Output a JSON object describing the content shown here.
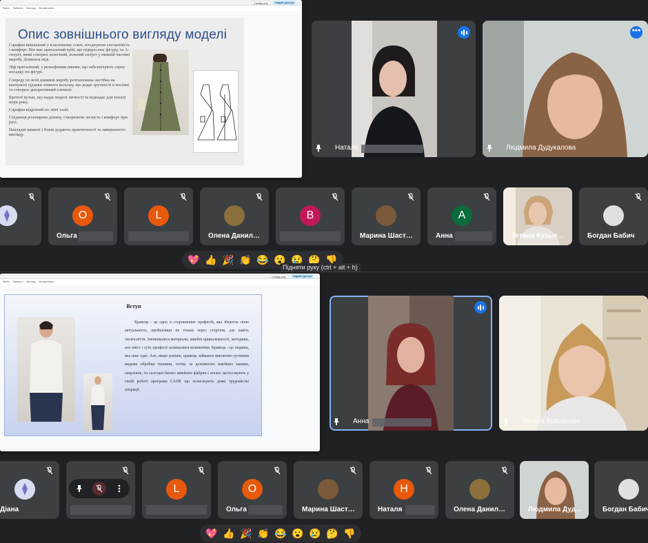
{
  "top": {
    "slides": {
      "toolbar": {
        "slideshow_label": "Слайд-шоу",
        "share_label": "Надати доступ"
      },
      "menu": [
        "Файл",
        "Змінити",
        "Вигляд",
        "Вставлення"
      ],
      "title": "Опис зовнішнього вигляду моделі",
      "paragraphs": [
        "Сарафан виконаний у класичному стилі, поєднуючи елегантність і комфорт. Він має приталений крій, що підкреслює фігуру, та А-силует, який створює жіночний, вільний силует у нижній частині виробу. Довжина міді.",
        "Ліф приталений, з рельєфними швами, що забезпечують гарну посадку по фігурі.",
        "Спереду по всій довжині виробу розташована застібка на контрасні ґудзики темного кольору, що додає зручності в носінні та створює декоративний елемент.",
        "Бретелі вузькі, що надає моделі легкості та відкидає для теплої пори року.",
        "Сарафан відрізний по лінії талії.",
        "Спідниця розширена донизу, створюючи легкість і комфорт при русі.",
        "Накладні кишені з боків додають практичності та завершеного вигляду."
      ]
    },
    "tiles": [
      {
        "name": "Наталя"
      },
      {
        "name": "Людмила Дудукалова"
      }
    ],
    "strip": [
      {
        "name": "",
        "avatar": "",
        "color": "#9aa0a6"
      },
      {
        "name": "Ольга",
        "avatar": "О",
        "color": "#e8590c"
      },
      {
        "name": "",
        "avatar": "L",
        "color": "#e8590c"
      },
      {
        "name": "Олена Данил…",
        "avatar": "",
        "color": "#9aa0a6"
      },
      {
        "name": "",
        "avatar": "В",
        "color": "#c2185b"
      },
      {
        "name": "Марина Шаст…",
        "avatar": "",
        "color": "#9aa0a6"
      },
      {
        "name": "Анна",
        "avatar": "А",
        "color": "#0b6b3a"
      },
      {
        "name": "Тетяна Кузьм…",
        "avatar": "",
        "color": "#9aa0a6"
      },
      {
        "name": "Богдан Бабич",
        "avatar": "",
        "color": "#9aa0a6"
      }
    ],
    "reactions": [
      "💖",
      "👍",
      "🎉",
      "👏",
      "😂",
      "😮",
      "😢",
      "🤔",
      "👎"
    ],
    "tooltip": "Підняти руку (ctrl + alt + h)"
  },
  "bottom": {
    "slides": {
      "toolbar": {
        "slideshow_label": "Слайд-шоу",
        "share_label": "Надати доступ"
      },
      "menu": [
        "Файл",
        "Змінити",
        "Вигляд",
        "Вставлення"
      ],
      "title": "Вступ",
      "body": "Кравець - це одна із старовинних професій, яка зберегла свою актуальність, пройшовши не тільки через сторіччя, але навіть тисячоліття. Змінювалися матеріали, швейні приналежності, методики, але зміст і суть професії залишалися колишніми. Кравець - це людина, яка шиє одяг. Але, якщо раніше, кравець займався виключно ручними видами обробки тканини, потім, за допомогою швейних машин, оверлоків, то сьогодні багато швейних фабрик і ательє застосовують у своїй роботі програми САПР, що полегшують деякі трудомісткі операції."
    },
    "tiles": [
      {
        "name": "Анна"
      },
      {
        "name": "Тетяна Кузьменко"
      }
    ],
    "strip": [
      {
        "name": "Діана",
        "avatar": "",
        "color": "#9aa0a6"
      },
      {
        "name": "",
        "avatar": "",
        "color": "#9aa0a6"
      },
      {
        "name": "",
        "avatar": "L",
        "color": "#e8590c"
      },
      {
        "name": "Ольга",
        "avatar": "О",
        "color": "#e8590c"
      },
      {
        "name": "Марина Шаст…",
        "avatar": "",
        "color": "#9aa0a6"
      },
      {
        "name": "Наталя",
        "avatar": "Н",
        "color": "#e8590c"
      },
      {
        "name": "Олена Данил…",
        "avatar": "",
        "color": "#9aa0a6"
      },
      {
        "name": "Людмила Дуд…",
        "avatar": "",
        "color": "#9aa0a6"
      },
      {
        "name": "Богдан Бабич",
        "avatar": "",
        "color": "#9aa0a6"
      }
    ],
    "reactions": [
      "💖",
      "👍",
      "🎉",
      "👏",
      "😂",
      "😮",
      "😢",
      "🤔",
      "👎"
    ]
  }
}
